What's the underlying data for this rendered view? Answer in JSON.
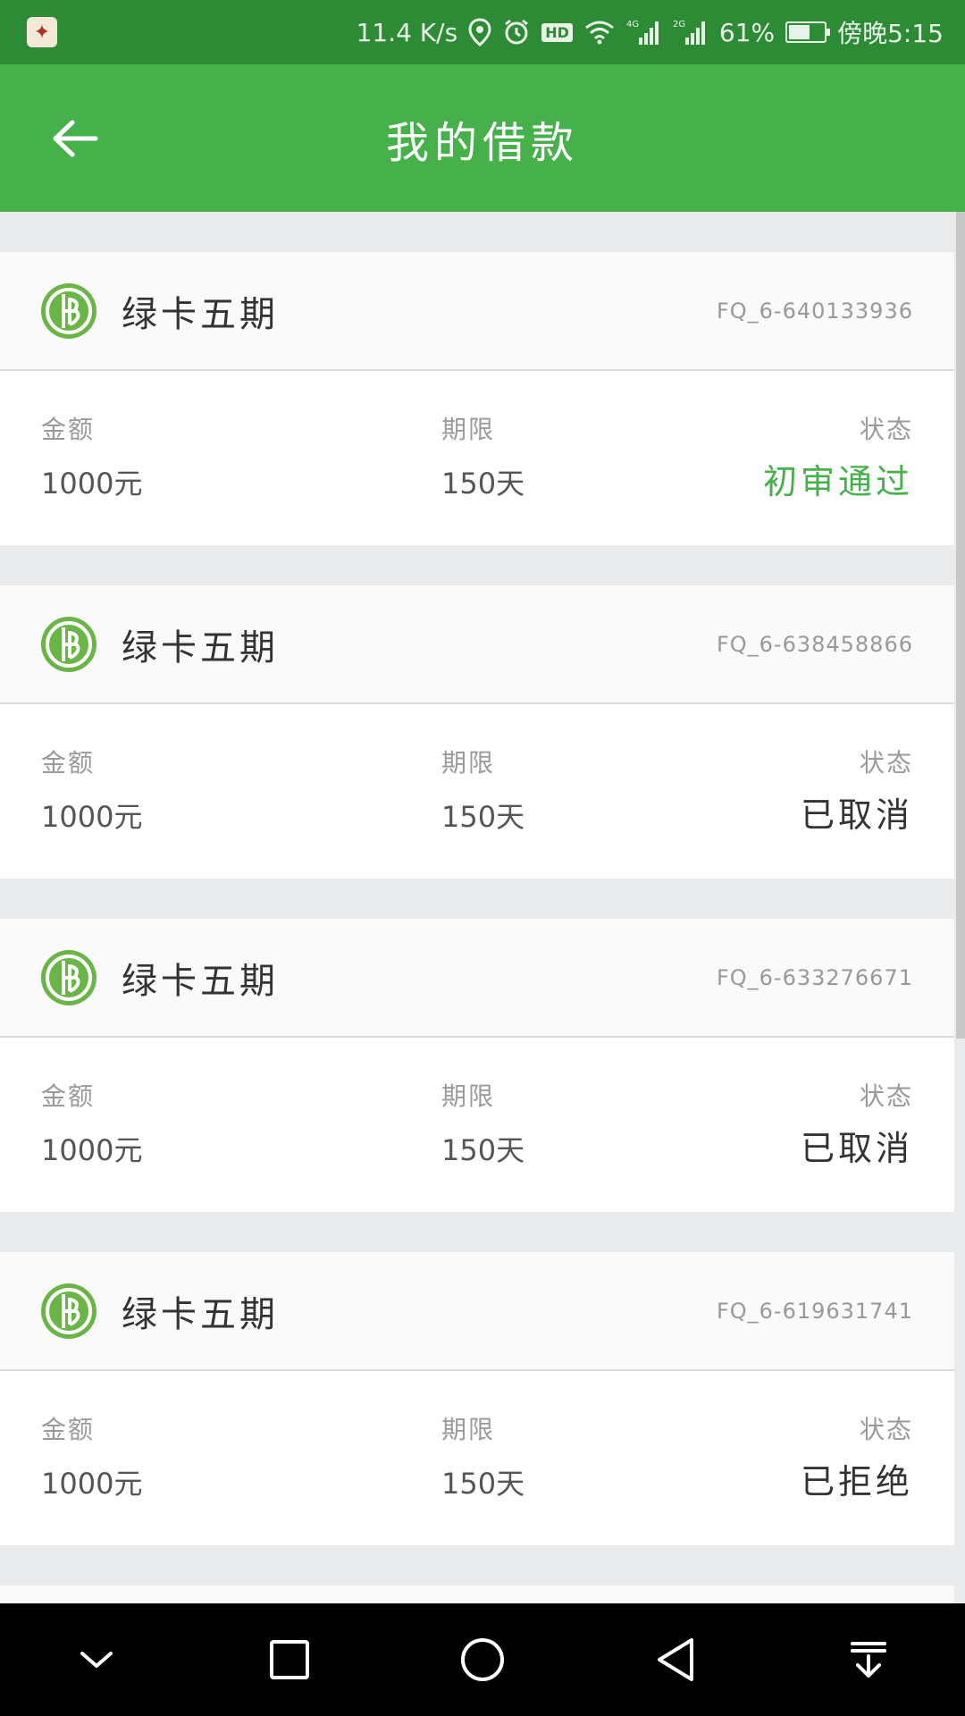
{
  "status_bar": {
    "speed": "11.4 K/s",
    "network1": "4G",
    "network2": "2G",
    "battery_percent": "61%",
    "battery_level": 0.61,
    "time": "傍晚5:15",
    "hd_label": "HD"
  },
  "header": {
    "title": "我的借款"
  },
  "labels": {
    "amount": "金额",
    "term": "期限",
    "status": "状态"
  },
  "colors": {
    "header_green": "#46b04a",
    "statusbar_green": "#2e8b35",
    "approved_green": "#46b04a",
    "neutral_status": "#333333"
  },
  "loans": [
    {
      "product": "绿卡五期",
      "id": "FQ_6-640133936",
      "amount": "1000元",
      "term": "150天",
      "status": "初审通过",
      "status_color": "#46b04a"
    },
    {
      "product": "绿卡五期",
      "id": "FQ_6-638458866",
      "amount": "1000元",
      "term": "150天",
      "status": "已取消",
      "status_color": "#333333"
    },
    {
      "product": "绿卡五期",
      "id": "FQ_6-633276671",
      "amount": "1000元",
      "term": "150天",
      "status": "已取消",
      "status_color": "#333333"
    },
    {
      "product": "绿卡五期",
      "id": "FQ_6-619631741",
      "amount": "1000元",
      "term": "150天",
      "status": "已拒绝",
      "status_color": "#333333"
    }
  ],
  "nav_icons": [
    "chevron-down-icon",
    "square-icon",
    "circle-icon",
    "triangle-back-icon",
    "download-tray-icon"
  ]
}
